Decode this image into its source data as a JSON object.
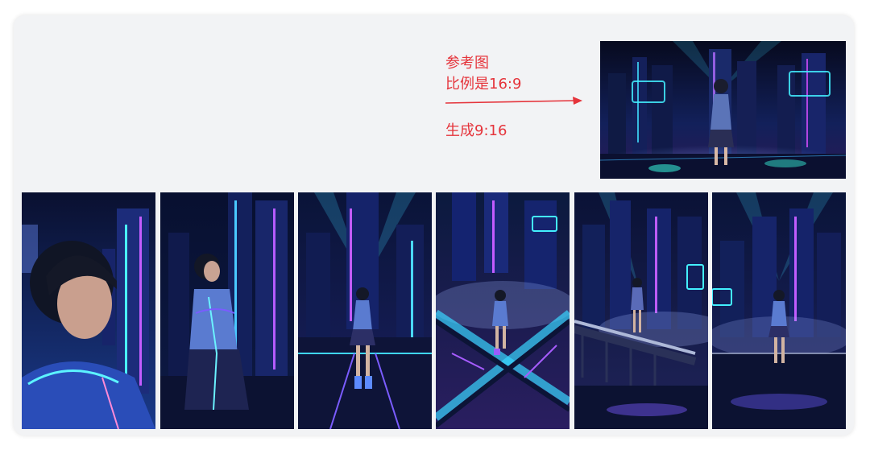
{
  "annotation": {
    "line1": "参考图",
    "line2": "比例是16:9",
    "line3": "生成9:16",
    "color": "#e5343b"
  },
  "reference_image": {
    "ratio": "16:9",
    "subject": "cyberpunk-city-girl"
  },
  "generated_images": [
    {
      "ratio": "9:16",
      "subject": "girl-closeup-looking-up"
    },
    {
      "ratio": "9:16",
      "subject": "girl-medium-shot-skyline"
    },
    {
      "ratio": "9:16",
      "subject": "girl-full-body-bridge"
    },
    {
      "ratio": "9:16",
      "subject": "girl-on-cross-bridge-topdown"
    },
    {
      "ratio": "9:16",
      "subject": "girl-on-railway-bridge"
    },
    {
      "ratio": "9:16",
      "subject": "girl-standing-city-fog"
    }
  ],
  "colors": {
    "card_bg": "#f2f3f5",
    "neon_cyan": "#35d7ff",
    "neon_purple": "#a45cff",
    "night": "#0a0d24"
  }
}
